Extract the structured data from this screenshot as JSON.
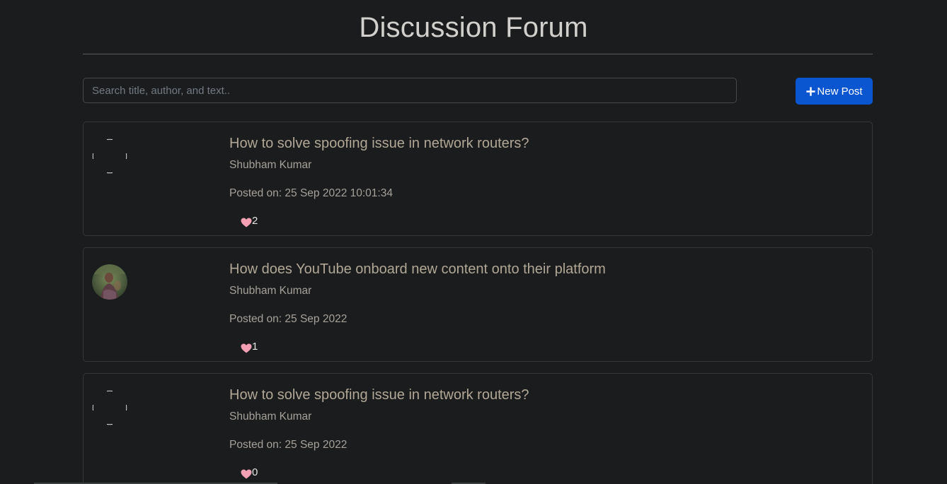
{
  "header": {
    "title": "Discussion Forum"
  },
  "search": {
    "placeholder": "Search title, author, and text.."
  },
  "actions": {
    "new_post_label": "New Post",
    "new_post_icon": "plus-icon"
  },
  "colors": {
    "accent": "#0a56d0",
    "background": "#1b1c1e",
    "heart": "#f4a0b4"
  },
  "posts": [
    {
      "title": "How to solve spoofing issue in network routers?",
      "author": "Shubham Kumar",
      "posted": "Posted on: 25 Sep 2022 10:01:34",
      "likes": "2",
      "avatar": "broken-image-icon"
    },
    {
      "title": "How does YouTube onboard new content onto their platform",
      "author": "Shubham Kumar",
      "posted": "Posted on: 25 Sep 2022",
      "likes": "1",
      "avatar": "user-photo"
    },
    {
      "title": "How to solve spoofing issue in network routers?",
      "author": "Shubham Kumar",
      "posted": "Posted on: 25 Sep 2022",
      "likes": "0",
      "avatar": "broken-image-icon"
    }
  ]
}
